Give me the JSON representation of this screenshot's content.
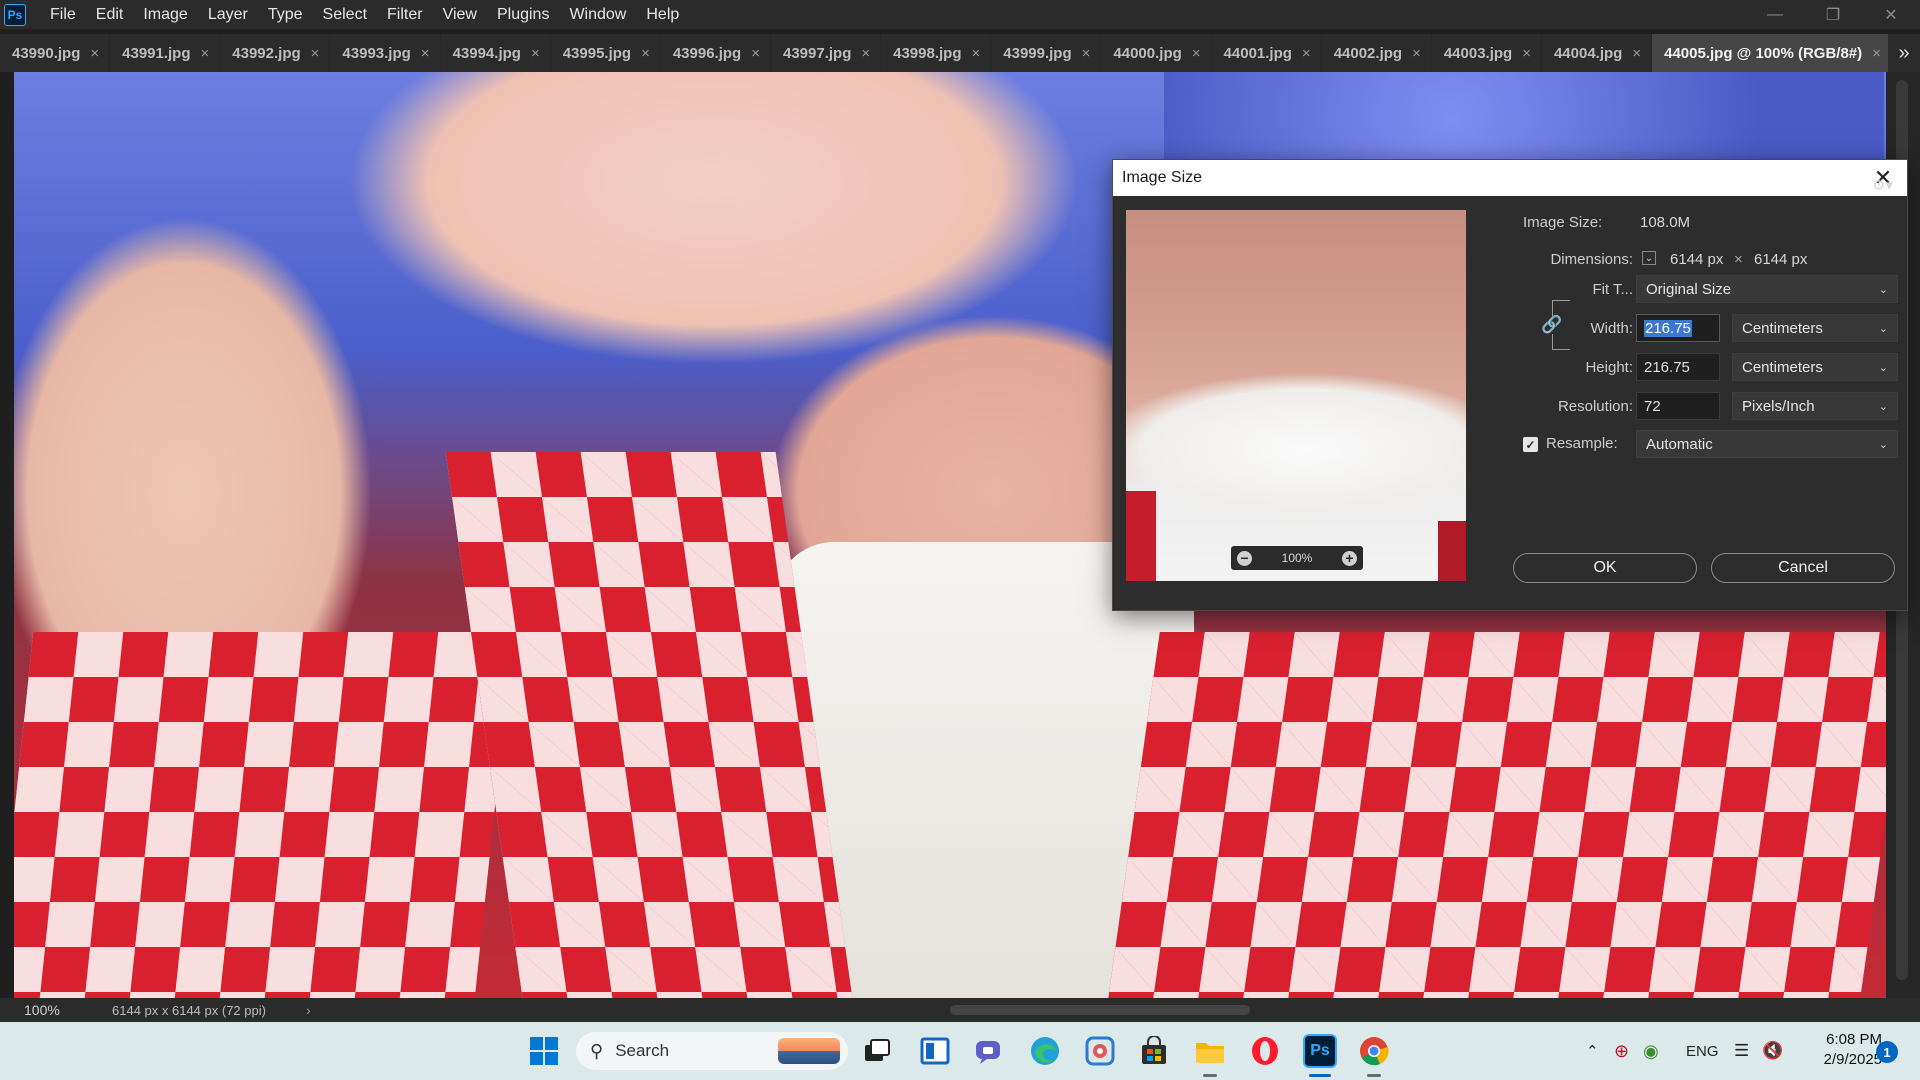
{
  "app": {
    "menu": [
      "File",
      "Edit",
      "Image",
      "Layer",
      "Type",
      "Select",
      "Filter",
      "View",
      "Plugins",
      "Window",
      "Help"
    ],
    "logo": "Ps"
  },
  "tabs": [
    {
      "label": "43990.jpg"
    },
    {
      "label": "43991.jpg"
    },
    {
      "label": "43992.jpg"
    },
    {
      "label": "43993.jpg"
    },
    {
      "label": "43994.jpg"
    },
    {
      "label": "43995.jpg"
    },
    {
      "label": "43996.jpg"
    },
    {
      "label": "43997.jpg"
    },
    {
      "label": "43998.jpg"
    },
    {
      "label": "43999.jpg"
    },
    {
      "label": "44000.jpg"
    },
    {
      "label": "44001.jpg"
    },
    {
      "label": "44002.jpg"
    },
    {
      "label": "44003.jpg"
    },
    {
      "label": "44004.jpg"
    },
    {
      "label": "44005.jpg @ 100% (RGB/8#)",
      "active": true
    }
  ],
  "tab_close_glyph": "×",
  "tab_overflow_glyph": "»",
  "status": {
    "zoom": "100%",
    "doc_info": "6144 px x 6144 px (72 ppi)",
    "arrow": "›"
  },
  "dialog": {
    "title": "Image Size",
    "image_size_label": "Image Size:",
    "image_size_value": "108.0M",
    "dimensions_label": "Dimensions:",
    "dim_width": "6144 px",
    "dim_times": "×",
    "dim_height": "6144 px",
    "fit_label": "Fit T...",
    "fit_value": "Original Size",
    "width_label": "Width:",
    "width_value": "216.75",
    "width_unit": "Centimeters",
    "height_label": "Height:",
    "height_value": "216.75",
    "height_unit": "Centimeters",
    "resolution_label": "Resolution:",
    "resolution_value": "72",
    "resolution_unit": "Pixels/Inch",
    "resample_label": "Resample:",
    "resample_checked": true,
    "resample_value": "Automatic",
    "preview_zoom": "100%",
    "ok_label": "OK",
    "cancel_label": "Cancel"
  },
  "taskbar": {
    "search_label": "Search",
    "language": "ENG",
    "time": "6:08 PM",
    "date": "2/9/2025",
    "notification_count": "1"
  },
  "colors": {
    "accent": "#31a8ff",
    "selection": "#3b78d0",
    "taskbar_bg": "#dbe9ea",
    "active_indicator": "#0067c0"
  }
}
